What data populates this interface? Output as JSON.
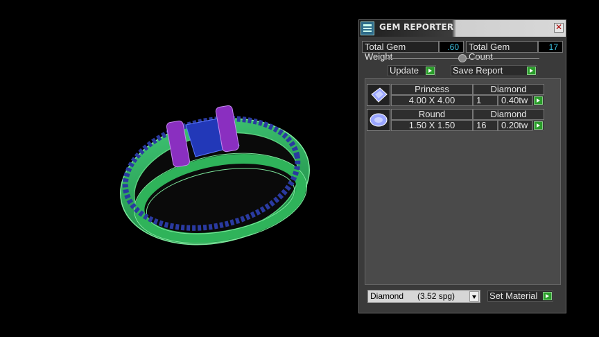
{
  "window": {
    "title": "GEM REPORTER",
    "close_glyph": "✕"
  },
  "summary": {
    "total_weight_label": "Total Gem Weight",
    "total_weight_value": ".60",
    "total_count_label": "Total Gem Count",
    "total_count_value": "17"
  },
  "buttons": {
    "update": "Update",
    "save_report": "Save Report",
    "set_material": "Set Material"
  },
  "gems": [
    {
      "shape": "Princess",
      "material": "Diamond",
      "size": "4.00 X 4.00",
      "count": "1",
      "weight": "0.40tw",
      "icon": "princess-cut-icon"
    },
    {
      "shape": "Round",
      "material": "Diamond",
      "size": "1.50 X 1.50",
      "count": "16",
      "weight": "0.20tw",
      "icon": "round-cut-icon"
    }
  ],
  "material_select": {
    "selected": "Diamond      (3.52 spg)"
  },
  "colors": {
    "ring_green": "#2fb35a",
    "prong_purple": "#8a2fc0",
    "center_blue": "#2040b0",
    "accent_value": "#3bc0e0"
  }
}
